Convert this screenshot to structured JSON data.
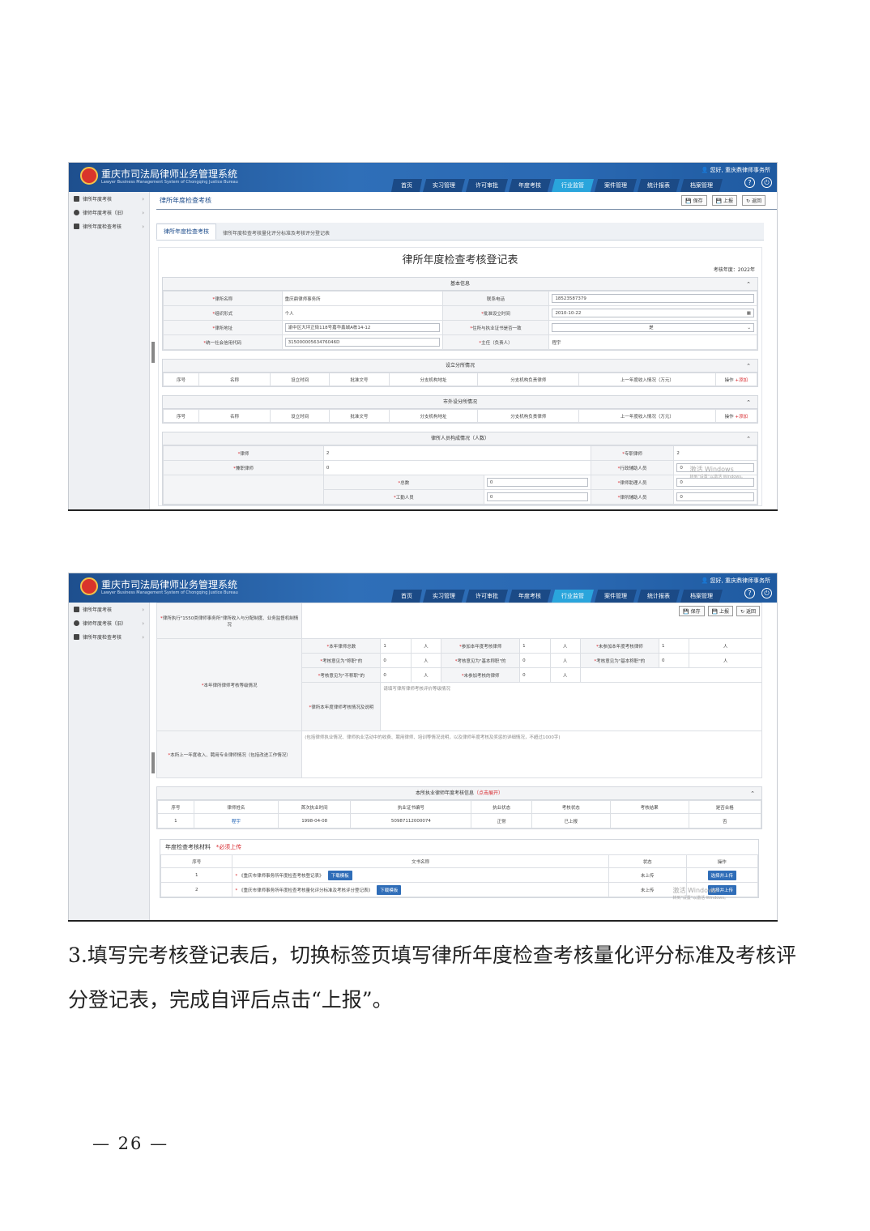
{
  "app": {
    "title": "重庆市司法局律师业务管理系统",
    "subtitle": "Lawyer Business Management System of Chongqing Justice Bureau",
    "user_greeting": "您好, 重庆鼎律师事务所",
    "nav": [
      "首页",
      "实习管理",
      "许可审批",
      "年度考核",
      "行业监管",
      "案件管理",
      "统计报表",
      "档案管理"
    ],
    "nav_active": "行业监管",
    "help_icon": "?",
    "power_icon": "⏻"
  },
  "sidebar": [
    {
      "label": "律所年度考核",
      "icon": "car-icon"
    },
    {
      "label": "律师年度考核（旧）",
      "icon": "gear-icon"
    },
    {
      "label": "律所年度检查考核",
      "icon": "calendar-icon"
    }
  ],
  "shot1": {
    "page_title": "律所年度检查考核",
    "buttons": [
      "保存",
      "上报",
      "返回"
    ],
    "tabs": [
      "律所年度检查考核",
      "律所年度检查考核量化评分标准及考核评分登记表"
    ],
    "form_title": "律所年度检查考核登记表",
    "year_label": "考核年度：2022年",
    "basic": {
      "head": "基本信息",
      "rows": [
        [
          "律所名称",
          "重庆鼎律师事务所",
          "联系电话",
          "18523587379"
        ],
        [
          "组织形式",
          "个人",
          "批准设立时间",
          "2010-10-22"
        ],
        [
          "律所地址",
          "渝中区大坪正街118号嘉华鑫城A栋14-12",
          "住所与执业证书是否一致",
          "是"
        ],
        [
          "统一社会信用代码",
          "31500000563476046D",
          "主任（负责人）",
          "程宇"
        ]
      ]
    },
    "branch_out": {
      "head": "设立分所情况",
      "cols": [
        "序号",
        "名称",
        "设立时间",
        "批准文号",
        "分支机构地址",
        "分支机构负责律师",
        "上一年度收入情况（万元）",
        "操作"
      ],
      "add": "+添加"
    },
    "branch_in": {
      "head": "市外设分所情况",
      "cols": [
        "序号",
        "名称",
        "设立时间",
        "批准文号",
        "分支机构地址",
        "分支机构负责律师",
        "上一年度收入情况（万元）",
        "操作"
      ],
      "add": "+添加"
    },
    "staff": {
      "head": "律所人员构成情况（人数）",
      "rows": [
        [
          "律师",
          "2",
          "专职律师",
          "2"
        ],
        [
          "兼职律师",
          "0",
          "行政辅助人员",
          "0"
        ]
      ],
      "sub_rows": [
        [
          "总数",
          "0",
          "律师助理人员",
          "0"
        ],
        [
          "工勤人员",
          "0",
          "律所辅助人员",
          "0"
        ]
      ]
    },
    "watermark": "激活 Windows",
    "watermark_sub": "转到\"设置\"以激活 Windows。"
  },
  "shot2": {
    "buttons": [
      "保存",
      "上报",
      "返回"
    ],
    "row_a_label": "律所执行\"1550类律师事务所\"律所收入与分配制度、业务监督机制情况",
    "assess_label": "本年律所律师考核等级情况",
    "assess_rows": [
      [
        "本年律师总数",
        "1",
        "人",
        "参加本年度考核律师",
        "1",
        "人",
        "未参加本年度考核律师",
        "1",
        "人"
      ],
      [
        "考核意见为\"称职\"的",
        "0",
        "人",
        "考核意见为\"基本称职\"的",
        "0",
        "人",
        "考核意见为\"基本称职\"的",
        "0",
        "人"
      ],
      [
        "考核意见为\"不称职\"的",
        "0",
        "人",
        "未参加考核的律师",
        "0",
        "人"
      ]
    ],
    "evidence_label": "律所本年度律师考核情况及说明",
    "evidence_hint": "请填写律所律师考核评价等级情况",
    "row_b_label": "本所上一年度收入、聘用专业律师情况（包括改进工作情况）",
    "row_b_hint": "(包括律师执业情况、律师执业活动中的收费、聘用律师、培训等情况说明，以及律师年度考核及奖惩的详细情况，不超过1000字)",
    "lawyer_table": {
      "head": "本所执业律师年度考核信息",
      "head_red": "（点击展开）",
      "cols": [
        "序号",
        "律师姓名",
        "首次执业时间",
        "执业证书编号",
        "执业状态",
        "考核状态",
        "考核结果",
        "是否合格"
      ],
      "rows": [
        [
          "1",
          "程宇",
          "1998-04-08",
          "50987112000074",
          "正常",
          "已上报",
          "",
          "否"
        ]
      ]
    },
    "materials": {
      "head": "年度检查考核材料",
      "head_red": "*必须上传",
      "cols": [
        "序号",
        "文书名称",
        "状态",
        "操作"
      ],
      "rows": [
        [
          "1",
          "《重庆市律师事务所年度检查考核登记表》",
          "下载模板",
          "未上传",
          "选择并上传"
        ],
        [
          "2",
          "《重庆市律师事务所年度检查考核量化评分标准及考核评分登记表》",
          "下载模板",
          "未上传",
          "选择并上传"
        ]
      ]
    },
    "watermark": "激活 Windows",
    "watermark_sub": "转到\"设置\"以激活 Windows。"
  },
  "text": {
    "paragraph": "3.填写完考核登记表后，切换标签页填写律所年度检查考核量化评分标准及考核评分登记表，完成自评后点击“上报”。",
    "page_number": "— 26 —"
  }
}
